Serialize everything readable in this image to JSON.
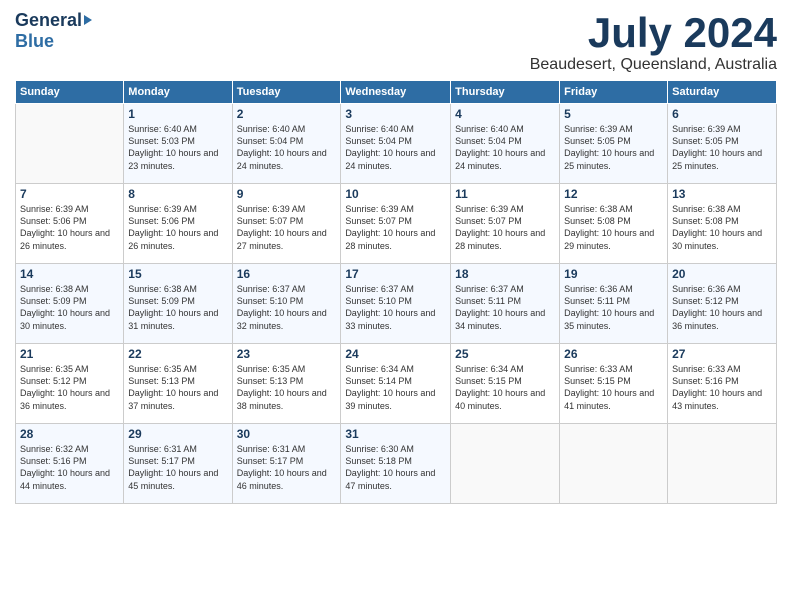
{
  "header": {
    "logo_general": "General",
    "logo_blue": "Blue",
    "month_title": "July 2024",
    "location": "Beaudesert, Queensland, Australia"
  },
  "columns": [
    "Sunday",
    "Monday",
    "Tuesday",
    "Wednesday",
    "Thursday",
    "Friday",
    "Saturday"
  ],
  "weeks": [
    [
      {
        "day": "",
        "info": ""
      },
      {
        "day": "1",
        "info": "Sunrise: 6:40 AM\nSunset: 5:03 PM\nDaylight: 10 hours\nand 23 minutes."
      },
      {
        "day": "2",
        "info": "Sunrise: 6:40 AM\nSunset: 5:04 PM\nDaylight: 10 hours\nand 24 minutes."
      },
      {
        "day": "3",
        "info": "Sunrise: 6:40 AM\nSunset: 5:04 PM\nDaylight: 10 hours\nand 24 minutes."
      },
      {
        "day": "4",
        "info": "Sunrise: 6:40 AM\nSunset: 5:04 PM\nDaylight: 10 hours\nand 24 minutes."
      },
      {
        "day": "5",
        "info": "Sunrise: 6:39 AM\nSunset: 5:05 PM\nDaylight: 10 hours\nand 25 minutes."
      },
      {
        "day": "6",
        "info": "Sunrise: 6:39 AM\nSunset: 5:05 PM\nDaylight: 10 hours\nand 25 minutes."
      }
    ],
    [
      {
        "day": "7",
        "info": "Sunrise: 6:39 AM\nSunset: 5:06 PM\nDaylight: 10 hours\nand 26 minutes."
      },
      {
        "day": "8",
        "info": "Sunrise: 6:39 AM\nSunset: 5:06 PM\nDaylight: 10 hours\nand 26 minutes."
      },
      {
        "day": "9",
        "info": "Sunrise: 6:39 AM\nSunset: 5:07 PM\nDaylight: 10 hours\nand 27 minutes."
      },
      {
        "day": "10",
        "info": "Sunrise: 6:39 AM\nSunset: 5:07 PM\nDaylight: 10 hours\nand 28 minutes."
      },
      {
        "day": "11",
        "info": "Sunrise: 6:39 AM\nSunset: 5:07 PM\nDaylight: 10 hours\nand 28 minutes."
      },
      {
        "day": "12",
        "info": "Sunrise: 6:38 AM\nSunset: 5:08 PM\nDaylight: 10 hours\nand 29 minutes."
      },
      {
        "day": "13",
        "info": "Sunrise: 6:38 AM\nSunset: 5:08 PM\nDaylight: 10 hours\nand 30 minutes."
      }
    ],
    [
      {
        "day": "14",
        "info": "Sunrise: 6:38 AM\nSunset: 5:09 PM\nDaylight: 10 hours\nand 30 minutes."
      },
      {
        "day": "15",
        "info": "Sunrise: 6:38 AM\nSunset: 5:09 PM\nDaylight: 10 hours\nand 31 minutes."
      },
      {
        "day": "16",
        "info": "Sunrise: 6:37 AM\nSunset: 5:10 PM\nDaylight: 10 hours\nand 32 minutes."
      },
      {
        "day": "17",
        "info": "Sunrise: 6:37 AM\nSunset: 5:10 PM\nDaylight: 10 hours\nand 33 minutes."
      },
      {
        "day": "18",
        "info": "Sunrise: 6:37 AM\nSunset: 5:11 PM\nDaylight: 10 hours\nand 34 minutes."
      },
      {
        "day": "19",
        "info": "Sunrise: 6:36 AM\nSunset: 5:11 PM\nDaylight: 10 hours\nand 35 minutes."
      },
      {
        "day": "20",
        "info": "Sunrise: 6:36 AM\nSunset: 5:12 PM\nDaylight: 10 hours\nand 36 minutes."
      }
    ],
    [
      {
        "day": "21",
        "info": "Sunrise: 6:35 AM\nSunset: 5:12 PM\nDaylight: 10 hours\nand 36 minutes."
      },
      {
        "day": "22",
        "info": "Sunrise: 6:35 AM\nSunset: 5:13 PM\nDaylight: 10 hours\nand 37 minutes."
      },
      {
        "day": "23",
        "info": "Sunrise: 6:35 AM\nSunset: 5:13 PM\nDaylight: 10 hours\nand 38 minutes."
      },
      {
        "day": "24",
        "info": "Sunrise: 6:34 AM\nSunset: 5:14 PM\nDaylight: 10 hours\nand 39 minutes."
      },
      {
        "day": "25",
        "info": "Sunrise: 6:34 AM\nSunset: 5:15 PM\nDaylight: 10 hours\nand 40 minutes."
      },
      {
        "day": "26",
        "info": "Sunrise: 6:33 AM\nSunset: 5:15 PM\nDaylight: 10 hours\nand 41 minutes."
      },
      {
        "day": "27",
        "info": "Sunrise: 6:33 AM\nSunset: 5:16 PM\nDaylight: 10 hours\nand 43 minutes."
      }
    ],
    [
      {
        "day": "28",
        "info": "Sunrise: 6:32 AM\nSunset: 5:16 PM\nDaylight: 10 hours\nand 44 minutes."
      },
      {
        "day": "29",
        "info": "Sunrise: 6:31 AM\nSunset: 5:17 PM\nDaylight: 10 hours\nand 45 minutes."
      },
      {
        "day": "30",
        "info": "Sunrise: 6:31 AM\nSunset: 5:17 PM\nDaylight: 10 hours\nand 46 minutes."
      },
      {
        "day": "31",
        "info": "Sunrise: 6:30 AM\nSunset: 5:18 PM\nDaylight: 10 hours\nand 47 minutes."
      },
      {
        "day": "",
        "info": ""
      },
      {
        "day": "",
        "info": ""
      },
      {
        "day": "",
        "info": ""
      }
    ]
  ]
}
